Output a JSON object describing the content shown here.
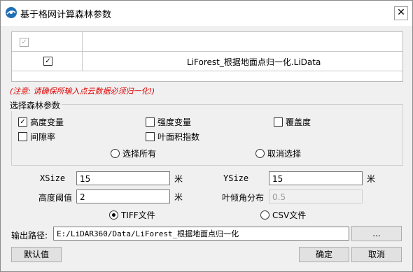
{
  "window": {
    "title": "基于格网计算森林参数",
    "close_glyph": "✕"
  },
  "table": {
    "row_file": "LiForest_根据地面点归一化.LiData",
    "check_glyph": "✓"
  },
  "warning": "(注意: 请确保所输入点云数据必须归一化!)",
  "forest_params": {
    "title": "选择森林参数",
    "options": [
      {
        "label": "高度变量",
        "checked": true
      },
      {
        "label": "强度变量",
        "checked": false
      },
      {
        "label": "覆盖度",
        "checked": false
      },
      {
        "label": "间隙率",
        "checked": false
      },
      {
        "label": "叶面积指数",
        "checked": false
      }
    ],
    "select_all": "选择所有",
    "deselect": "取消选择"
  },
  "params": {
    "xsize_label": "XSize",
    "xsize_value": "15",
    "xsize_unit": "米",
    "ysize_label": "YSize",
    "ysize_value": "15",
    "ysize_unit": "米",
    "height_label": "高度阈值",
    "height_value": "2",
    "height_unit": "米",
    "leaf_label": "叶倾角分布",
    "leaf_value": "0.5"
  },
  "format": {
    "tiff": "TIFF文件",
    "csv": "CSV文件",
    "selected": "tiff"
  },
  "output": {
    "label": "输出路径:",
    "path": "E:/LiDAR360/Data/LiForest_根据地面点归一化",
    "browse": "..."
  },
  "buttons": {
    "default": "默认值",
    "ok": "确定",
    "cancel": "取消"
  },
  "colors": {
    "warning": "#e00000"
  }
}
